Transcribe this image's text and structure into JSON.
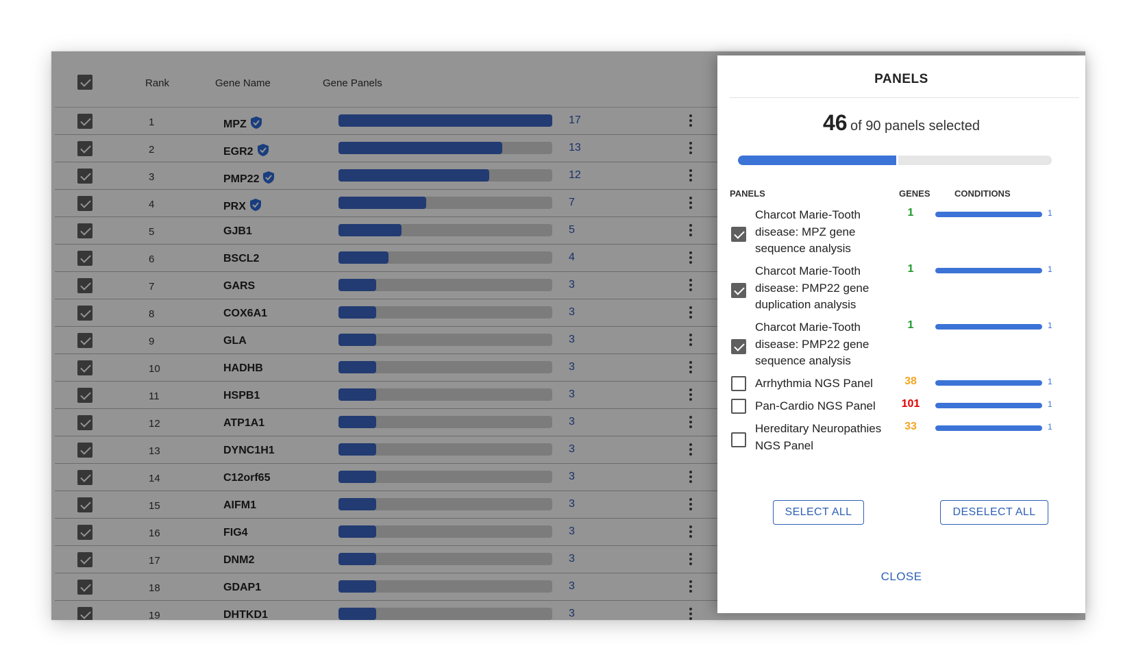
{
  "table": {
    "headers": {
      "rank": "Rank",
      "gene_name": "Gene Name",
      "gene_panels": "Gene Panels"
    },
    "max_count": 17,
    "rows": [
      {
        "rank": "1",
        "gene": "MPZ",
        "count": 17,
        "verified": true
      },
      {
        "rank": "2",
        "gene": "EGR2",
        "count": 13,
        "verified": true
      },
      {
        "rank": "3",
        "gene": "PMP22",
        "count": 12,
        "verified": true
      },
      {
        "rank": "4",
        "gene": "PRX",
        "count": 7,
        "verified": true
      },
      {
        "rank": "5",
        "gene": "GJB1",
        "count": 5,
        "verified": false
      },
      {
        "rank": "6",
        "gene": "BSCL2",
        "count": 4,
        "verified": false
      },
      {
        "rank": "7",
        "gene": "GARS",
        "count": 3,
        "verified": false
      },
      {
        "rank": "8",
        "gene": "COX6A1",
        "count": 3,
        "verified": false
      },
      {
        "rank": "9",
        "gene": "GLA",
        "count": 3,
        "verified": false
      },
      {
        "rank": "10",
        "gene": "HADHB",
        "count": 3,
        "verified": false
      },
      {
        "rank": "11",
        "gene": "HSPB1",
        "count": 3,
        "verified": false
      },
      {
        "rank": "12",
        "gene": "ATP1A1",
        "count": 3,
        "verified": false
      },
      {
        "rank": "13",
        "gene": "DYNC1H1",
        "count": 3,
        "verified": false
      },
      {
        "rank": "14",
        "gene": "C12orf65",
        "count": 3,
        "verified": false
      },
      {
        "rank": "15",
        "gene": "AIFM1",
        "count": 3,
        "verified": false
      },
      {
        "rank": "16",
        "gene": "FIG4",
        "count": 3,
        "verified": false
      },
      {
        "rank": "17",
        "gene": "DNM2",
        "count": 3,
        "verified": false
      },
      {
        "rank": "18",
        "gene": "GDAP1",
        "count": 3,
        "verified": false
      },
      {
        "rank": "19",
        "gene": "DHTKD1",
        "count": 3,
        "verified": false
      }
    ],
    "icons": {
      "verified": "shield-check-icon",
      "row_menu": "kebab-menu-icon"
    }
  },
  "modal": {
    "title": "PANELS",
    "selected_count": "46",
    "selected_suffix": "of 90 panels selected",
    "selected_fraction": 0.511,
    "columns": {
      "panels": "PANELS",
      "genes": "GENES",
      "conditions": "CONDITIONS"
    },
    "panels": [
      {
        "name": "Charcot Marie-Tooth disease: MPZ gene sequence analysis",
        "checked": true,
        "genes": "1",
        "genes_color": "#1e9a2c",
        "conditions": "1"
      },
      {
        "name": "Charcot Marie-Tooth disease: PMP22 gene duplication analysis",
        "checked": true,
        "genes": "1",
        "genes_color": "#1e9a2c",
        "conditions": "1"
      },
      {
        "name": "Charcot Marie-Tooth disease: PMP22 gene sequence analysis",
        "checked": true,
        "genes": "1",
        "genes_color": "#1e9a2c",
        "conditions": "1"
      },
      {
        "name": "Arrhythmia NGS Panel",
        "checked": false,
        "genes": "38",
        "genes_color": "#f5a623",
        "conditions": "1"
      },
      {
        "name": "Pan-Cardio NGS Panel",
        "checked": false,
        "genes": "101",
        "genes_color": "#e00000",
        "conditions": "1"
      },
      {
        "name": "Hereditary Neuropathies NGS Panel",
        "checked": false,
        "genes": "33",
        "genes_color": "#f5a623",
        "conditions": "1"
      }
    ],
    "select_all": "SELECT ALL",
    "deselect_all": "DESELECT ALL",
    "close": "CLOSE"
  },
  "colors": {
    "accent": "#3c73d7",
    "link": "#2d5fb5",
    "table_bar": "#3b66c4"
  }
}
